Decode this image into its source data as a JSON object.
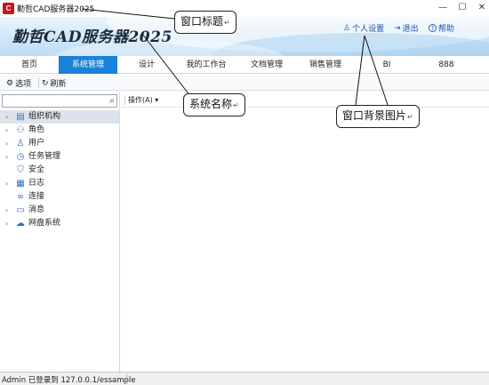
{
  "window": {
    "icon_text": "C",
    "title": "勤哲CAD服务器2025",
    "minimize": "—",
    "maximize": "☐",
    "close": "✕"
  },
  "banner": {
    "system_name": "勤哲CAD服务器2025",
    "links": [
      {
        "icon": "user-icon",
        "glyph": "♙",
        "label": "个人设置"
      },
      {
        "icon": "exit-icon",
        "glyph": "⇥",
        "label": "退出"
      },
      {
        "icon": "help-icon",
        "glyph": "?",
        "label": "帮助"
      }
    ]
  },
  "menu": {
    "tabs": [
      "首页",
      "系统管理",
      "设计",
      "我的工作台",
      "文档管理",
      "销售管理",
      "BI",
      "888"
    ],
    "active": "系统管理"
  },
  "toolbar": {
    "options_label": "选项",
    "refresh_label": "刷新"
  },
  "left": {
    "search_placeholder": "",
    "tree": [
      {
        "label": "组织机构",
        "icon": "org-icon",
        "glyph": "▤",
        "expandable": true,
        "selected": true
      },
      {
        "label": "角色",
        "icon": "roles-icon",
        "glyph": "⚇",
        "expandable": true,
        "selected": false
      },
      {
        "label": "用户",
        "icon": "user-icon",
        "glyph": "♙",
        "expandable": true,
        "selected": false
      },
      {
        "label": "任务管理",
        "icon": "clock-icon",
        "glyph": "◷",
        "expandable": true,
        "selected": false
      },
      {
        "label": "安全",
        "icon": "shield-icon",
        "glyph": "⛉",
        "expandable": false,
        "selected": false
      },
      {
        "label": "日志",
        "icon": "log-icon",
        "glyph": "▦",
        "expandable": true,
        "selected": false
      },
      {
        "label": "连接",
        "icon": "link-icon",
        "glyph": "∞",
        "expandable": false,
        "selected": false
      },
      {
        "label": "消息",
        "icon": "message-icon",
        "glyph": "▭",
        "expandable": true,
        "selected": false
      },
      {
        "label": "网盘系统",
        "icon": "cloud-icon",
        "glyph": "☁",
        "expandable": true,
        "selected": false
      }
    ]
  },
  "content": {
    "operations_label": "操作(A)",
    "operations_arrow": "▾"
  },
  "status": {
    "text": "Admin 已登录到 127.0.0.1/essample"
  },
  "annotations": {
    "window_title": "窗口标题",
    "system_name": "系统名称",
    "background_image": "窗口背景图片",
    "mark": "↵"
  },
  "colors": {
    "accent": "#1a82d8",
    "banner_top": "#eaf4fc",
    "banner_bottom": "#bfdcf3",
    "link": "#1f4fa8",
    "icon": "#2d6fc5"
  }
}
